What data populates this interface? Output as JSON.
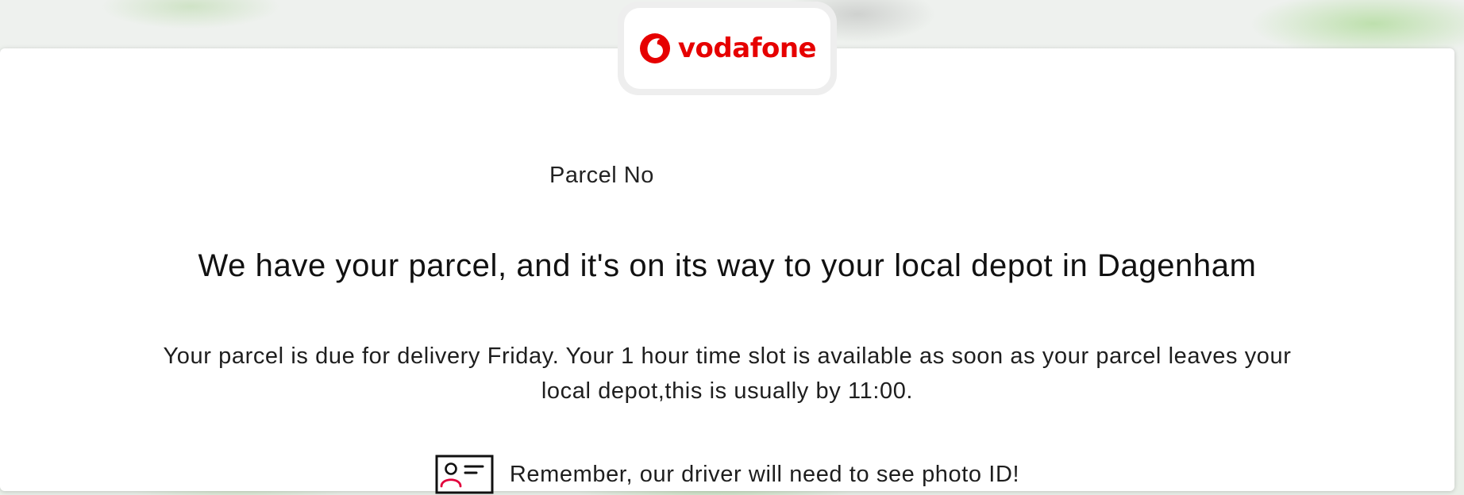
{
  "brand": {
    "name": "vodafone",
    "color": "#e60000",
    "logo_icon": "vodafone-speechmark-icon"
  },
  "parcel": {
    "number_label": "Parcel No"
  },
  "status": {
    "headline": "We have your parcel, and it's on its way to your local depot in Dagenham",
    "delivery_info": "Your parcel is due for delivery Friday. Your 1 hour time slot is available as soon as your parcel leaves your local depot,this is usually by 11:00."
  },
  "reminder": {
    "icon": "id-card-icon",
    "text": "Remember, our driver will need to see photo ID!",
    "icon_accent_color": "#e2003b"
  }
}
